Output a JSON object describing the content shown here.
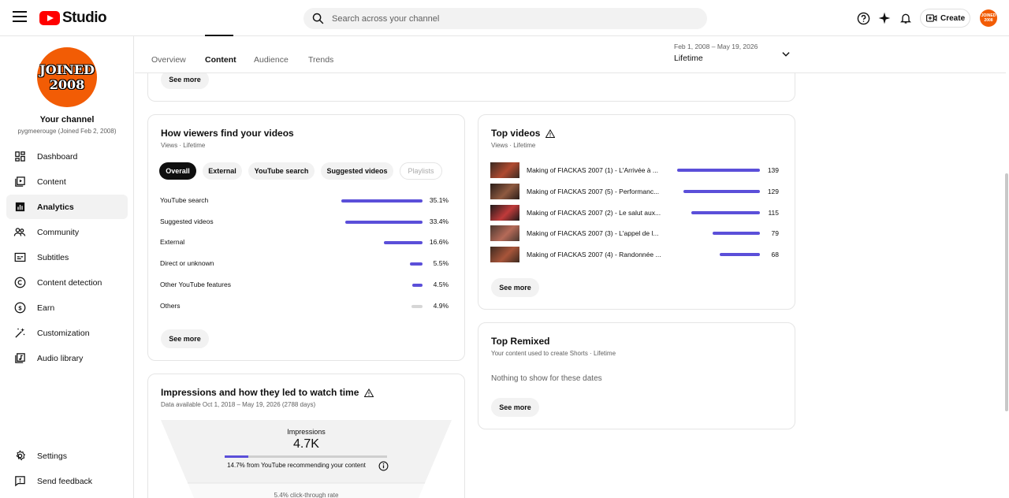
{
  "header": {
    "logo_text": "Studio",
    "search_placeholder": "Search across your channel",
    "create_label": "Create",
    "avatar_text": "JOINED 2008"
  },
  "sidebar": {
    "avatar_line1": "JOINED",
    "avatar_line2": "2008",
    "channel_title": "Your channel",
    "channel_sub": "pygmeerouge (Joined Feb 2, 2008)",
    "items": [
      {
        "label": "Dashboard"
      },
      {
        "label": "Content"
      },
      {
        "label": "Analytics"
      },
      {
        "label": "Community"
      },
      {
        "label": "Subtitles"
      },
      {
        "label": "Content detection"
      },
      {
        "label": "Earn"
      },
      {
        "label": "Customization"
      },
      {
        "label": "Audio library"
      }
    ],
    "settings_label": "Settings",
    "feedback_label": "Send feedback"
  },
  "tabs": {
    "items": [
      "Overview",
      "Content",
      "Audience",
      "Trends"
    ],
    "active": "Content",
    "date_range": "Feb 1, 2008 – May 19, 2026",
    "date_label": "Lifetime"
  },
  "top_card": {
    "see_more": "See more"
  },
  "viewers": {
    "title": "How viewers find your videos",
    "subtitle": "Views · Lifetime",
    "filters": [
      "Overall",
      "External",
      "YouTube search",
      "Suggested videos",
      "Playlists"
    ],
    "rows": [
      {
        "label": "YouTube search",
        "pct_text": "35.1%",
        "pct": 35.1
      },
      {
        "label": "Suggested videos",
        "pct_text": "33.4%",
        "pct": 33.4
      },
      {
        "label": "External",
        "pct_text": "16.6%",
        "pct": 16.6
      },
      {
        "label": "Direct or unknown",
        "pct_text": "5.5%",
        "pct": 5.5
      },
      {
        "label": "Other YouTube features",
        "pct_text": "4.5%",
        "pct": 4.5
      },
      {
        "label": "Others",
        "pct_text": "4.9%",
        "pct": 4.9
      }
    ],
    "see_more": "See more"
  },
  "top_videos": {
    "title": "Top videos",
    "subtitle": "Views · Lifetime",
    "rows": [
      {
        "title": "Making of FIACKAS 2007 (1) - L'Arrivée à ...",
        "views": "139",
        "value": 139
      },
      {
        "title": "Making of FIACKAS 2007 (5) - Performanc...",
        "views": "129",
        "value": 129
      },
      {
        "title": "Making of FIACKAS 2007 (2) - Le salut aux...",
        "views": "115",
        "value": 115
      },
      {
        "title": "Making of FIACKAS 2007 (3) - L'appel de l...",
        "views": "79",
        "value": 79
      },
      {
        "title": "Making of FIACKAS 2007 (4) - Randonnée ...",
        "views": "68",
        "value": 68
      }
    ],
    "see_more": "See more"
  },
  "top_remixed": {
    "title": "Top Remixed",
    "subtitle": "Your content used to create Shorts · Lifetime",
    "empty_text": "Nothing to show for these dates",
    "see_more": "See more"
  },
  "impressions": {
    "title": "Impressions and how they led to watch time",
    "subtitle": "Data available Oct 1, 2018 – May 19, 2026 (2788 days)",
    "impressions_label": "Impressions",
    "impressions_value": "4.7K",
    "recommend_pct": 14.7,
    "recommend_text": "14.7% from YouTube recommending your content",
    "ctr_text": "5.4% click-through rate"
  },
  "colors": {
    "accent": "#5b4fd9",
    "brand": "#ff0000",
    "avatar": "#f25c05"
  }
}
